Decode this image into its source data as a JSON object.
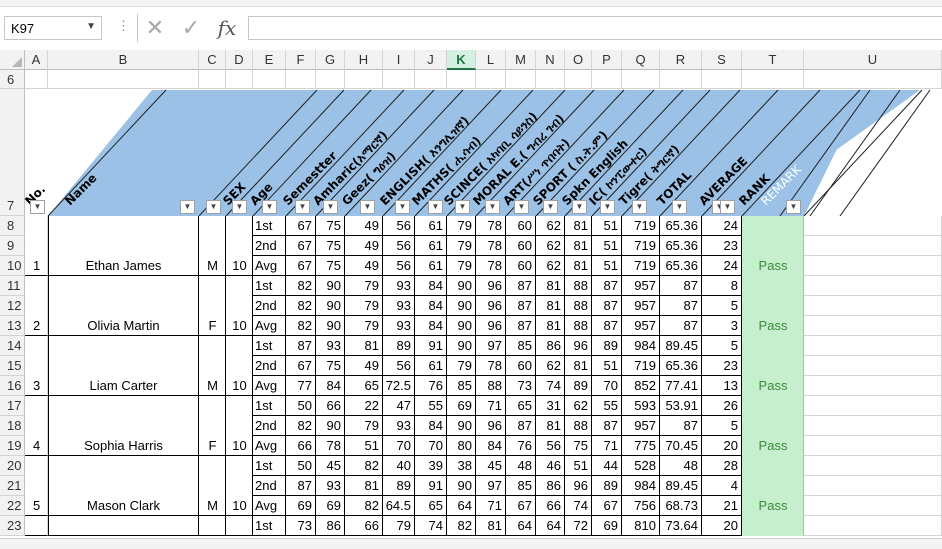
{
  "formula_bar": {
    "name_box": "K97",
    "formula": ""
  },
  "columns": [
    "A",
    "B",
    "C",
    "D",
    "E",
    "F",
    "G",
    "H",
    "I",
    "J",
    "K",
    "L",
    "M",
    "N",
    "O",
    "P",
    "Q",
    "R",
    "S",
    "T",
    "U"
  ],
  "selected_column": "K",
  "row_labels": [
    "6",
    "7",
    "8",
    "9",
    "10",
    "11",
    "12",
    "13",
    "14",
    "15",
    "16",
    "17",
    "18",
    "19",
    "20",
    "21",
    "22",
    "23"
  ],
  "headers": [
    "No.",
    "Name",
    "",
    "SEX",
    "Age",
    "Semestter",
    "Amharic(አማርኛ)",
    "Geez( ግዕዝ)",
    "ENGLISH( እንግሊዝኛ)",
    "MATHS( ሒሳብ)",
    "SCINCE( አካባቢ ሳይንስ)",
    "MORAL E.( ግብረ ገብ)",
    "ART(ሥነ ጥበባት)",
    "SPORT ( ስ.ት.ም)",
    "Spkn English",
    "IC( ኮንፒውተር)",
    "Tigre( ትግርኛ)",
    "TOTAL",
    "AVERAGE",
    "RANK",
    "REMARK"
  ],
  "students": [
    {
      "no": "1",
      "name": "Ethan James",
      "sex": "M",
      "age": "10",
      "remark": "Pass",
      "rows": [
        {
          "sem": "1st",
          "vals": [
            "67",
            "75",
            "49",
            "56",
            "61",
            "79",
            "78",
            "60",
            "62",
            "81",
            "51",
            "719",
            "65.36",
            "24"
          ]
        },
        {
          "sem": "2nd",
          "vals": [
            "67",
            "75",
            "49",
            "56",
            "61",
            "79",
            "78",
            "60",
            "62",
            "81",
            "51",
            "719",
            "65.36",
            "23"
          ]
        },
        {
          "sem": "Avg",
          "vals": [
            "67",
            "75",
            "49",
            "56",
            "61",
            "79",
            "78",
            "60",
            "62",
            "81",
            "51",
            "719",
            "65.36",
            "24"
          ]
        }
      ]
    },
    {
      "no": "2",
      "name": "Olivia Martin",
      "sex": "F",
      "age": "10",
      "remark": "Pass",
      "rows": [
        {
          "sem": "1st",
          "vals": [
            "82",
            "90",
            "79",
            "93",
            "84",
            "90",
            "96",
            "87",
            "81",
            "88",
            "87",
            "957",
            "87",
            "8"
          ]
        },
        {
          "sem": "2nd",
          "vals": [
            "82",
            "90",
            "79",
            "93",
            "84",
            "90",
            "96",
            "87",
            "81",
            "88",
            "87",
            "957",
            "87",
            "5"
          ]
        },
        {
          "sem": "Avg",
          "vals": [
            "82",
            "90",
            "79",
            "93",
            "84",
            "90",
            "96",
            "87",
            "81",
            "88",
            "87",
            "957",
            "87",
            "3"
          ]
        }
      ]
    },
    {
      "no": "3",
      "name": "Liam Carter",
      "sex": "M",
      "age": "10",
      "remark": "Pass",
      "rows": [
        {
          "sem": "1st",
          "vals": [
            "87",
            "93",
            "81",
            "89",
            "91",
            "90",
            "97",
            "85",
            "86",
            "96",
            "89",
            "984",
            "89.45",
            "5"
          ]
        },
        {
          "sem": "2nd",
          "vals": [
            "67",
            "75",
            "49",
            "56",
            "61",
            "79",
            "78",
            "60",
            "62",
            "81",
            "51",
            "719",
            "65.36",
            "23"
          ]
        },
        {
          "sem": "Avg",
          "vals": [
            "77",
            "84",
            "65",
            "72.5",
            "76",
            "85",
            "88",
            "73",
            "74",
            "89",
            "70",
            "852",
            "77.41",
            "13"
          ]
        }
      ]
    },
    {
      "no": "4",
      "name": "Sophia Harris",
      "sex": "F",
      "age": "10",
      "remark": "Pass",
      "rows": [
        {
          "sem": "1st",
          "vals": [
            "50",
            "66",
            "22",
            "47",
            "55",
            "69",
            "71",
            "65",
            "31",
            "62",
            "55",
            "593",
            "53.91",
            "26"
          ]
        },
        {
          "sem": "2nd",
          "vals": [
            "82",
            "90",
            "79",
            "93",
            "84",
            "90",
            "96",
            "87",
            "81",
            "88",
            "87",
            "957",
            "87",
            "5"
          ]
        },
        {
          "sem": "Avg",
          "vals": [
            "66",
            "78",
            "51",
            "70",
            "70",
            "80",
            "84",
            "76",
            "56",
            "75",
            "71",
            "775",
            "70.45",
            "20"
          ]
        }
      ]
    },
    {
      "no": "5",
      "name": "Mason Clark",
      "sex": "M",
      "age": "10",
      "remark": "Pass",
      "rows": [
        {
          "sem": "1st",
          "vals": [
            "50",
            "45",
            "82",
            "40",
            "39",
            "38",
            "45",
            "48",
            "46",
            "51",
            "44",
            "528",
            "48",
            "28"
          ]
        },
        {
          "sem": "2nd",
          "vals": [
            "87",
            "93",
            "81",
            "89",
            "91",
            "90",
            "97",
            "85",
            "86",
            "96",
            "89",
            "984",
            "89.45",
            "4"
          ]
        },
        {
          "sem": "Avg",
          "vals": [
            "69",
            "69",
            "82",
            "64.5",
            "65",
            "64",
            "71",
            "67",
            "66",
            "74",
            "67",
            "756",
            "68.73",
            "21"
          ]
        }
      ]
    },
    {
      "no": "",
      "name": "",
      "sex": "",
      "age": "",
      "remark": "",
      "rows": [
        {
          "sem": "1st",
          "vals": [
            "73",
            "86",
            "66",
            "79",
            "74",
            "82",
            "81",
            "64",
            "64",
            "72",
            "69",
            "810",
            "73.64",
            "20"
          ]
        }
      ]
    }
  ],
  "colors": {
    "header_fill": "#9bc2e6",
    "remark_fill": "#c6efce",
    "pass_text": "#3b8a3b",
    "selected_col": "#217346"
  },
  "icons": [
    "dropdown-arrow-icon",
    "cancel-icon",
    "enter-icon",
    "function-icon",
    "filter-dropdown-icon"
  ]
}
